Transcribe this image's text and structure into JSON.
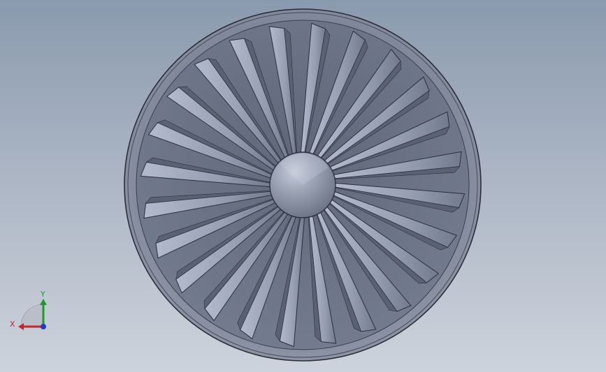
{
  "viewport": {
    "background_top": "#8a9aae",
    "background_bottom": "#cdd3dc"
  },
  "model": {
    "blade_count": 24,
    "hub_color": "#8f96a6",
    "blade_color": "#9aa2b6",
    "shroud_color": "#7e8598"
  },
  "triad": {
    "x_label": "X",
    "y_label": "Y",
    "x_color": "#c0262c",
    "y_color": "#1f9a2a",
    "z_color": "#1b3fbf"
  }
}
